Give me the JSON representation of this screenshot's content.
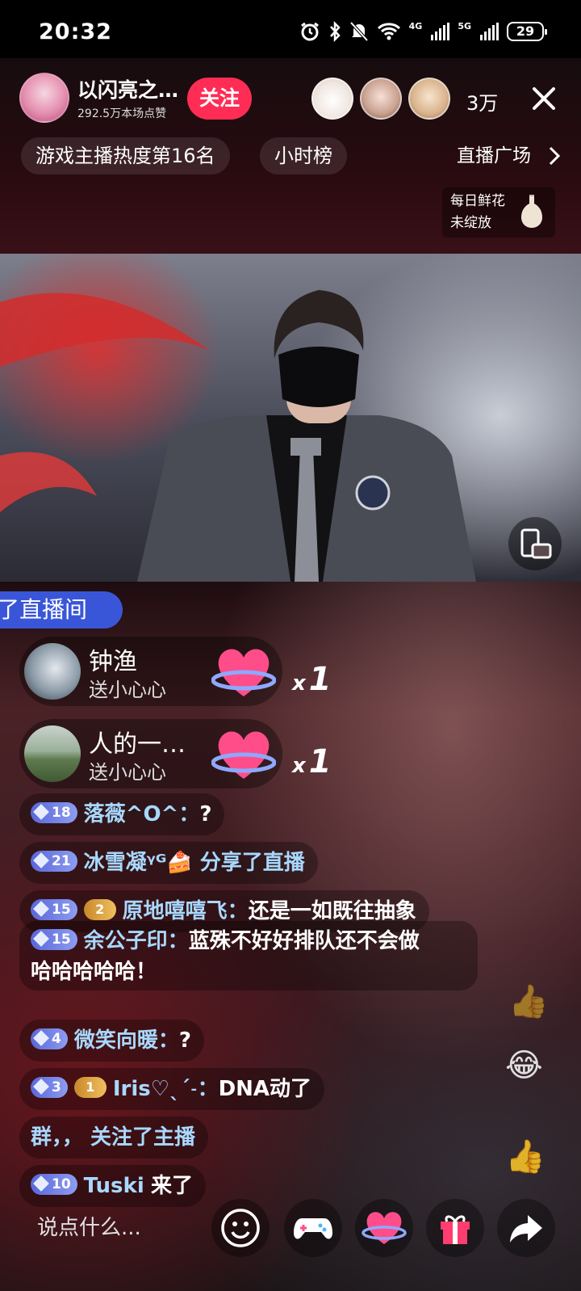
{
  "status_bar": {
    "time": "20:32",
    "net1": "4G",
    "net2": "5G",
    "battery": "29"
  },
  "host": {
    "name": "以闪亮之…",
    "likes": "292.5万本场点赞",
    "follow_label": "关注"
  },
  "viewers": {
    "count": "3万"
  },
  "ranking": {
    "rank_label": "游戏主播热度第16名",
    "hourly_label": "小时榜",
    "square_label": "直播广场"
  },
  "flower": {
    "line1": "每日鲜花",
    "line2": "未绽放"
  },
  "chat": {
    "entry_banner": "了直播间",
    "gifts": [
      {
        "name": "钟渔",
        "action": "送小心心",
        "count": "1",
        "count_prefix": "x"
      },
      {
        "name": "人的一…",
        "action": "送小心心",
        "count": "1",
        "count_prefix": "x"
      }
    ],
    "messages": [
      {
        "level": "18",
        "user": "落薇^O^：",
        "text": "?"
      },
      {
        "level": "21",
        "user": "冰雪凝ᵞᴳ🍰 分享了直播",
        "text": ""
      },
      {
        "level": "15",
        "fan_level": "2",
        "user": "原地嘻嘻飞：",
        "text": "还是一如既往抽象"
      },
      {
        "level": "15",
        "user": "余公子印：",
        "text": "蓝殊不好好排队还不会做",
        "text2": "哈哈哈哈哈！"
      },
      {
        "level": "4",
        "user": "微笑向暖：",
        "text": "?"
      },
      {
        "level": "3",
        "fan_level": "1",
        "user": "Iris♡ˎˊ˗：",
        "text": "DNA动了"
      },
      {
        "level": "",
        "user": "群，， 关注了主播",
        "text": ""
      },
      {
        "level": "10",
        "user": "Tuski",
        "text": "来了"
      }
    ]
  },
  "bottom": {
    "input_placeholder": "说点什么..."
  },
  "icons": {
    "alarm": "alarm-icon",
    "bluetooth": "bluetooth-icon",
    "mute": "mute-icon",
    "wifi": "wifi-icon",
    "close": "close-icon",
    "chevron": "chevron-right-icon",
    "vase": "vase-icon",
    "rotate": "rotate-screen-icon",
    "emoji": "emoji-icon",
    "game": "gamepad-icon",
    "heart": "heart-icon",
    "gift": "gift-icon",
    "share": "share-icon"
  },
  "colors": {
    "follow": "#ff2c55",
    "banner": "#3a56d8",
    "username": "#a8d8ff"
  }
}
